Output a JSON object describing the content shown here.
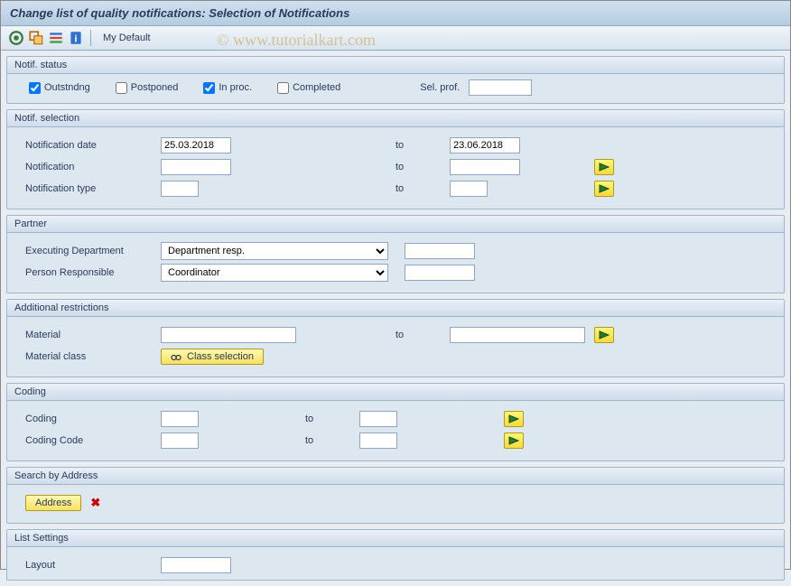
{
  "title": "Change list of quality notifications: Selection of Notifications",
  "watermark": "© www.tutorialkart.com",
  "toolbar": {
    "my_default": "My Default"
  },
  "groups": {
    "notif_status": {
      "header": "Notif. status",
      "outstanding": "Outstndng",
      "postponed": "Postponed",
      "in_proc": "In proc.",
      "completed": "Completed",
      "sel_prof": "Sel. prof."
    },
    "notif_selection": {
      "header": "Notif. selection",
      "notification_date": "Notification date",
      "notification": "Notification",
      "notification_type": "Notification type",
      "date_from": "25.03.2018",
      "date_to": "23.06.2018",
      "to": "to"
    },
    "partner": {
      "header": "Partner",
      "executing_dept": "Executing Department",
      "person_resp": "Person Responsible",
      "dept_resp_value": "Department resp.",
      "coordinator_value": "Coordinator"
    },
    "additional": {
      "header": "Additional restrictions",
      "material": "Material",
      "material_class": "Material class",
      "class_selection": "Class selection",
      "to": "to"
    },
    "coding": {
      "header": "Coding",
      "coding": "Coding",
      "coding_code": "Coding Code",
      "to": "to"
    },
    "search_address": {
      "header": "Search by Address",
      "address": "Address"
    },
    "list_settings": {
      "header": "List Settings",
      "layout": "Layout"
    }
  }
}
